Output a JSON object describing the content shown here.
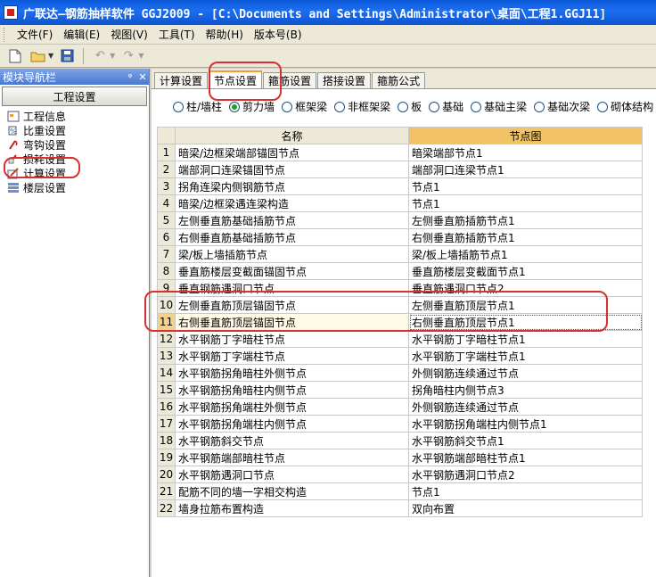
{
  "window": {
    "title": "广联达—钢筋抽样软件 GGJ2009 - [C:\\Documents and Settings\\Administrator\\桌面\\工程1.GGJ11]"
  },
  "menu": [
    "文件(F)",
    "编辑(E)",
    "视图(V)",
    "工具(T)",
    "帮助(H)",
    "版本号(B)"
  ],
  "toolbar": {
    "buttons": [
      "new-file",
      "open-folder",
      "save",
      "undo",
      "redo"
    ]
  },
  "nav": {
    "header": "模块导航栏",
    "pin": "ᵠ",
    "close": "✕",
    "section": "工程设置",
    "items": [
      "工程信息",
      "比重设置",
      "弯钩设置",
      "损耗设置",
      "计算设置",
      "楼层设置"
    ]
  },
  "tabs": [
    "计算设置",
    "节点设置",
    "箍筋设置",
    "搭接设置",
    "箍筋公式"
  ],
  "active_tab": 1,
  "radios": [
    "柱/墙柱",
    "剪力墙",
    "框架梁",
    "非框架梁",
    "板",
    "基础",
    "基础主梁",
    "基础次梁",
    "砌体结构"
  ],
  "selected_radio": 1,
  "table": {
    "headers": [
      "",
      "名称",
      "节点图"
    ],
    "rows": [
      [
        "1",
        "暗梁/边框梁端部锚固节点",
        "暗梁端部节点1"
      ],
      [
        "2",
        "端部洞口连梁锚固节点",
        "端部洞口连梁节点1"
      ],
      [
        "3",
        "拐角连梁内侧钢筋节点",
        "节点1"
      ],
      [
        "4",
        "暗梁/边框梁遇连梁构造",
        "节点1"
      ],
      [
        "5",
        "左侧垂直筋基础插筋节点",
        "左侧垂直筋插筋节点1"
      ],
      [
        "6",
        "右侧垂直筋基础插筋节点",
        "右侧垂直筋插筋节点1"
      ],
      [
        "7",
        "梁/板上墙插筋节点",
        "梁/板上墙插筋节点1"
      ],
      [
        "8",
        "垂直筋楼层变截面锚固节点",
        "垂直筋楼层变截面节点1"
      ],
      [
        "9",
        "垂直钢筋遇洞口节点",
        "垂直筋遇洞口节点2"
      ],
      [
        "10",
        "左侧垂直筋顶层锚固节点",
        "左侧垂直筋顶层节点1"
      ],
      [
        "11",
        "右侧垂直筋顶层锚固节点",
        "右侧垂直筋顶层节点1"
      ],
      [
        "12",
        "水平钢筋丁字暗柱节点",
        "水平钢筋丁字暗柱节点1"
      ],
      [
        "13",
        "水平钢筋丁字端柱节点",
        "水平钢筋丁字端柱节点1"
      ],
      [
        "14",
        "水平钢筋拐角暗柱外侧节点",
        "外侧钢筋连续通过节点"
      ],
      [
        "15",
        "水平钢筋拐角暗柱内侧节点",
        "拐角暗柱内侧节点3"
      ],
      [
        "16",
        "水平钢筋拐角端柱外侧节点",
        "外侧钢筋连续通过节点"
      ],
      [
        "17",
        "水平钢筋拐角端柱内侧节点",
        "水平钢筋拐角端柱内侧节点1"
      ],
      [
        "18",
        "水平钢筋斜交节点",
        "水平钢筋斜交节点1"
      ],
      [
        "19",
        "水平钢筋端部暗柱节点",
        "水平钢筋端部暗柱节点1"
      ],
      [
        "20",
        "水平钢筋遇洞口节点",
        "水平钢筋遇洞口节点2"
      ],
      [
        "21",
        "配筋不同的墙一字相交构造",
        "节点1"
      ],
      [
        "22",
        "墙身拉筋布置构造",
        "双向布置"
      ]
    ],
    "selected_row": 11
  },
  "colors": {
    "title_bar": "#0f55d0",
    "highlight": "#d83030",
    "header_node": "#f2c266",
    "panel": "#ece9d8"
  }
}
